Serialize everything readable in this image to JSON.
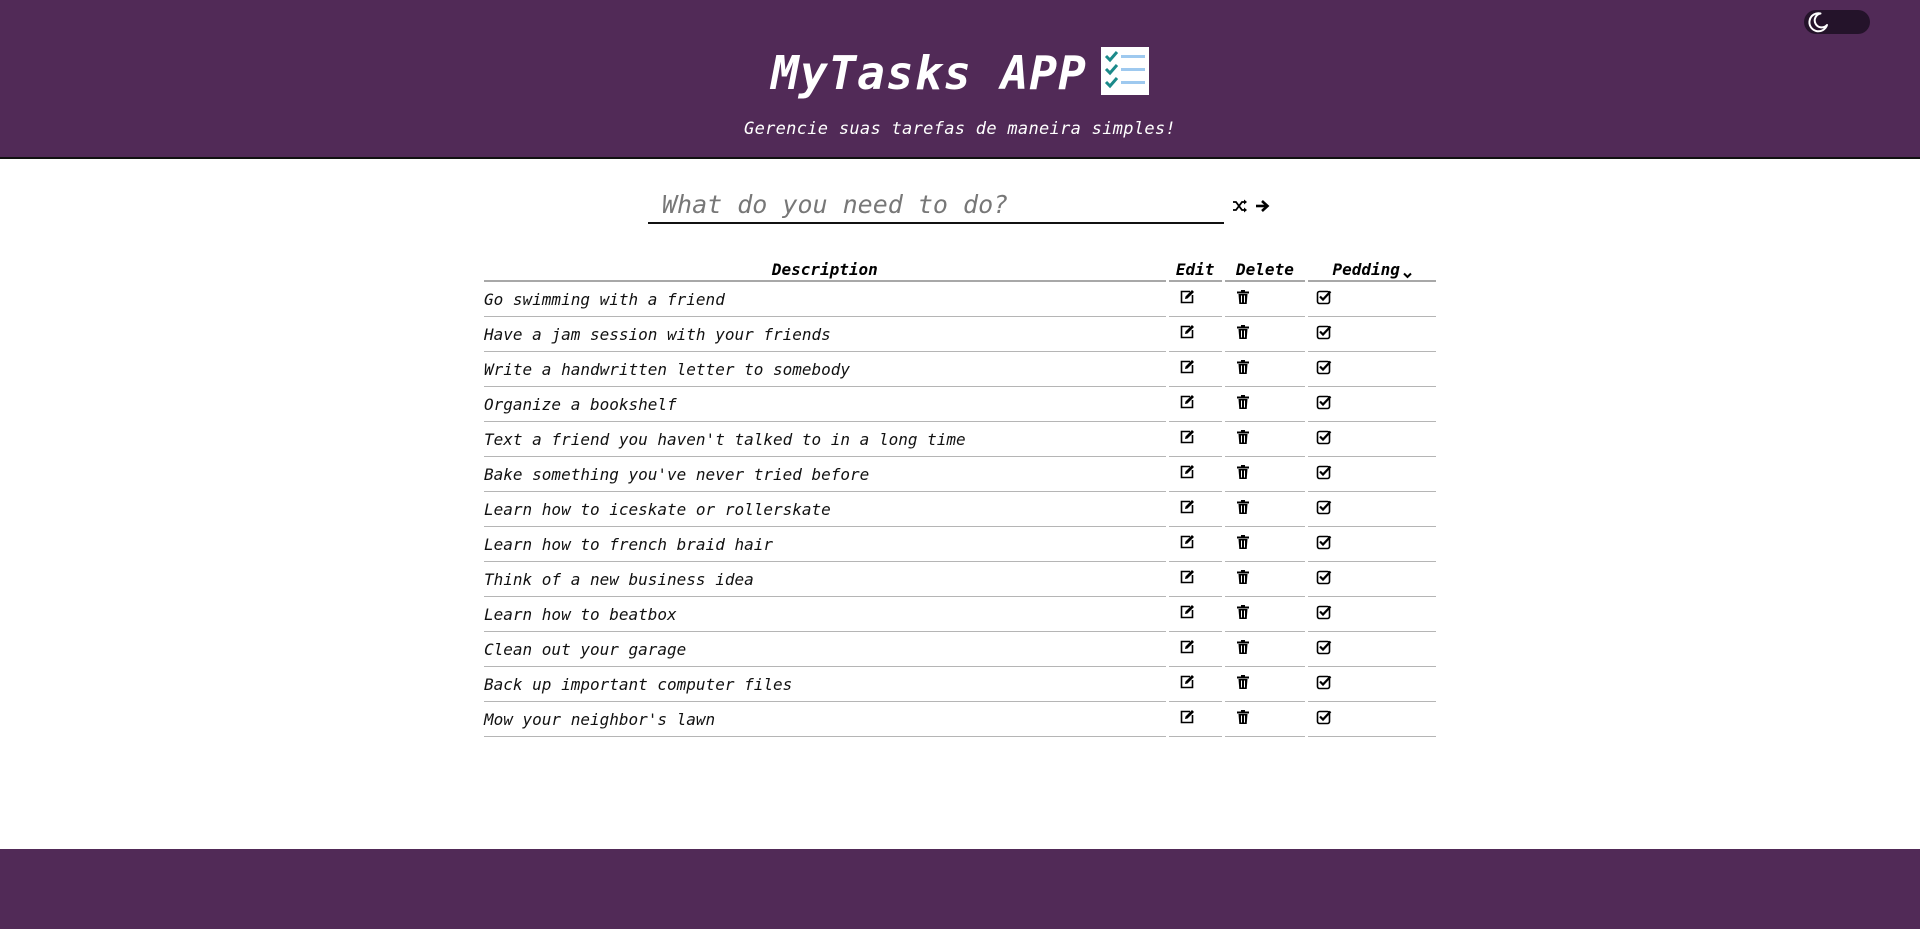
{
  "header": {
    "title": "MyTasks APP",
    "subtitle": "Gerencie suas tarefas de maneira simples!",
    "logo_icon": "checklist-icon",
    "background_color": "#512a57"
  },
  "theme_toggle": {
    "icon": "moon-icon",
    "state": "dark"
  },
  "task_input": {
    "placeholder": "What do you need to do?",
    "value": "",
    "shuffle_icon": "shuffle-icon",
    "submit_icon": "arrow-right-icon"
  },
  "table": {
    "headers": {
      "description": "Description",
      "edit": "Edit",
      "delete": "Delete",
      "status": "Pedding"
    },
    "rows": [
      {
        "description": "Go swimming with a friend"
      },
      {
        "description": "Have a jam session with your friends"
      },
      {
        "description": "Write a handwritten letter to somebody"
      },
      {
        "description": "Organize a bookshelf"
      },
      {
        "description": "Text a friend you haven't talked to in a long time"
      },
      {
        "description": "Bake something you've never tried before"
      },
      {
        "description": "Learn how to iceskate or rollerskate"
      },
      {
        "description": "Learn how to french braid hair"
      },
      {
        "description": "Think of a new business idea"
      },
      {
        "description": "Learn how to beatbox"
      },
      {
        "description": "Clean out your garage"
      },
      {
        "description": "Back up important computer files"
      },
      {
        "description": "Mow your neighbor's lawn"
      }
    ],
    "row_icons": {
      "edit": "edit-icon",
      "delete": "trash-icon",
      "status": "check-square-icon"
    }
  },
  "footer": {
    "background_color": "#512a57"
  }
}
